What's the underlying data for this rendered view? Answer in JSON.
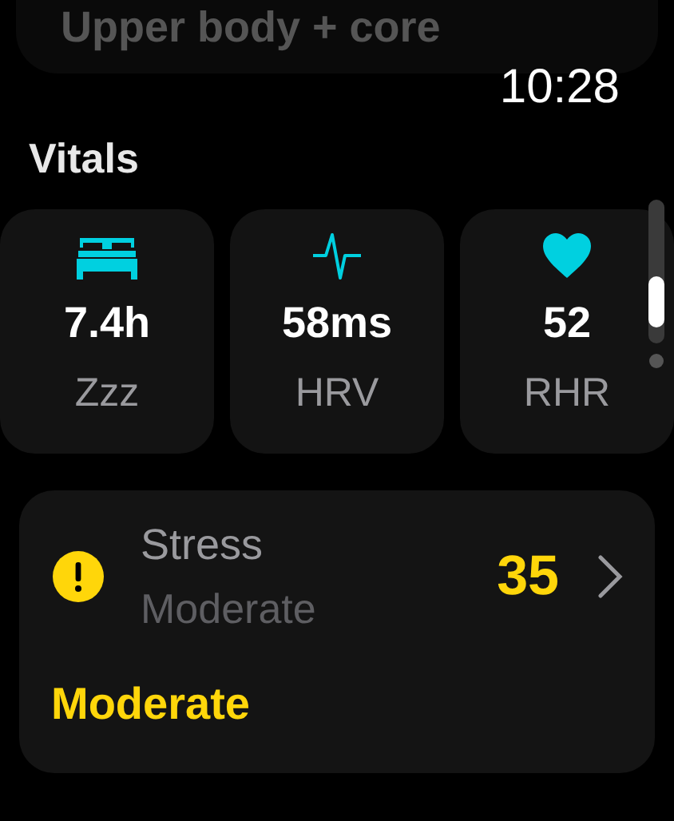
{
  "previous_card": {
    "title": "Upper body + core"
  },
  "time": "10:28",
  "section_title": "Vitals",
  "vitals": [
    {
      "kind": "sleep",
      "value": "7.4h",
      "label": "Zzz"
    },
    {
      "kind": "variability",
      "value": "58ms",
      "label": "HRV"
    },
    {
      "kind": "rate",
      "value": "52",
      "label": "RHR"
    }
  ],
  "stress": {
    "title": "Stress",
    "subtitle": "Moderate",
    "score": "35",
    "status": "Moderate",
    "color": "#ffd60a"
  }
}
